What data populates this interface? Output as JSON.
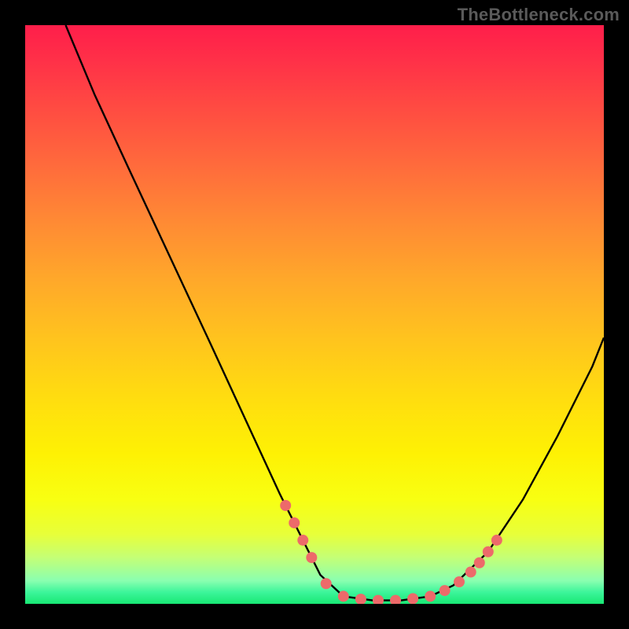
{
  "attribution": "TheBottleneck.com",
  "chart_data": {
    "type": "line",
    "title": "",
    "xlabel": "",
    "ylabel": "",
    "xlim": [
      0,
      100
    ],
    "ylim": [
      0,
      100
    ],
    "curve": {
      "name": "bottleneck-curve",
      "color": "#000000",
      "points": [
        {
          "x": 7,
          "y": 100
        },
        {
          "x": 12,
          "y": 88
        },
        {
          "x": 18,
          "y": 75
        },
        {
          "x": 25,
          "y": 60
        },
        {
          "x": 32,
          "y": 45
        },
        {
          "x": 38,
          "y": 32
        },
        {
          "x": 44,
          "y": 19
        },
        {
          "x": 48,
          "y": 11
        },
        {
          "x": 51,
          "y": 5
        },
        {
          "x": 55,
          "y": 1.3
        },
        {
          "x": 60,
          "y": 0.6
        },
        {
          "x": 65,
          "y": 0.6
        },
        {
          "x": 70,
          "y": 1.3
        },
        {
          "x": 74,
          "y": 3.2
        },
        {
          "x": 80,
          "y": 9
        },
        {
          "x": 86,
          "y": 18
        },
        {
          "x": 92,
          "y": 29
        },
        {
          "x": 98,
          "y": 41
        },
        {
          "x": 100,
          "y": 46
        }
      ]
    },
    "markers": {
      "name": "highlight-dots",
      "color": "#ed6a6a",
      "radius": 7,
      "points": [
        {
          "x": 45,
          "y": 17
        },
        {
          "x": 46.5,
          "y": 14
        },
        {
          "x": 48,
          "y": 11
        },
        {
          "x": 49.5,
          "y": 8
        },
        {
          "x": 52,
          "y": 3.5
        },
        {
          "x": 55,
          "y": 1.3
        },
        {
          "x": 58,
          "y": 0.8
        },
        {
          "x": 61,
          "y": 0.6
        },
        {
          "x": 64,
          "y": 0.6
        },
        {
          "x": 67,
          "y": 0.9
        },
        {
          "x": 70,
          "y": 1.3
        },
        {
          "x": 72.5,
          "y": 2.3
        },
        {
          "x": 75,
          "y": 3.8
        },
        {
          "x": 77,
          "y": 5.5
        },
        {
          "x": 78.5,
          "y": 7.1
        },
        {
          "x": 80,
          "y": 9
        },
        {
          "x": 81.5,
          "y": 11
        }
      ]
    }
  }
}
